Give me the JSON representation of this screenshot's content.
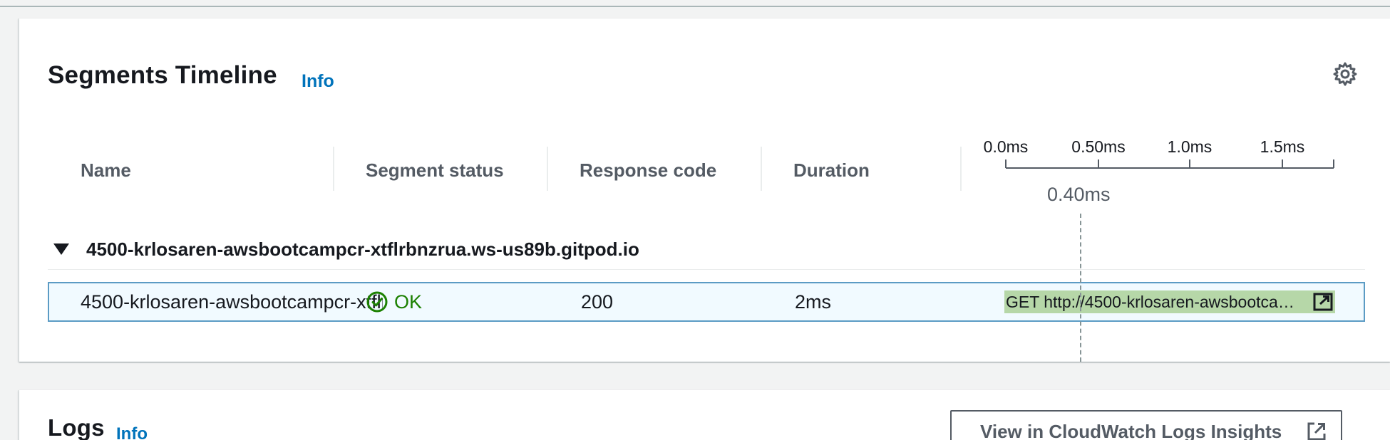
{
  "timeline": {
    "title": "Segments Timeline",
    "info_label": "Info",
    "columns": {
      "name": "Name",
      "segment_status": "Segment status",
      "response_code": "Response code",
      "duration": "Duration"
    },
    "axis_ticks": [
      "0.0ms",
      "0.50ms",
      "1.0ms",
      "1.5ms"
    ],
    "cursor_label": "0.40ms",
    "group": {
      "label": "4500-krlosaren-awsbootcampcr-xtflrbnzrua.ws-us89b.gitpod.io",
      "expanded": true
    },
    "segment": {
      "name": "4500-krlosaren-awsbootcampcr-xtflrbnzrua.ws-us89b.gitpod.io",
      "status": "OK",
      "response_code": "200",
      "duration": "2ms",
      "bar_label": "GET http://4500-krlosaren-awsbootcampcr-xtflrbnzrua.ws-us89b.gitpod.io/"
    }
  },
  "logs": {
    "title": "Logs",
    "info_label": "Info",
    "cloudwatch_button": "View in CloudWatch Logs Insights"
  },
  "colors": {
    "link": "#0073bb",
    "status_ok": "#1d8102",
    "bar_fill": "#b6d7a8",
    "row_selected_bg": "#f1faff",
    "row_selected_border": "#5b9bc4"
  },
  "icons": {
    "settings": "gear-icon",
    "expand": "caret-down-icon",
    "status": "check-circle-icon",
    "external": "external-link-icon"
  }
}
